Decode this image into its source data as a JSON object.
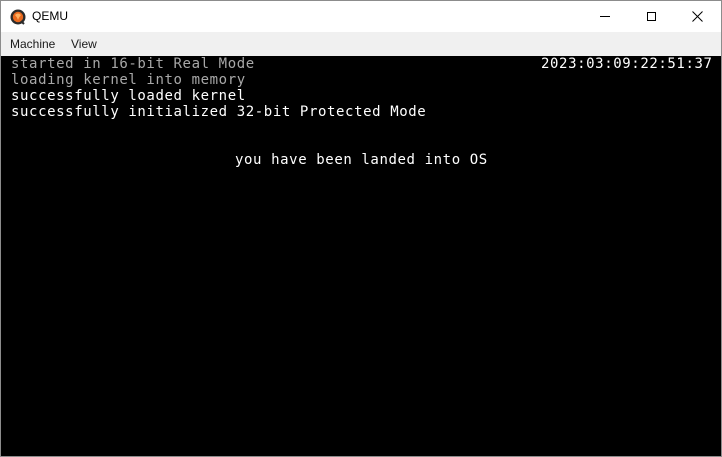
{
  "window": {
    "title": "QEMU",
    "icon": "qemu-logo-icon"
  },
  "controls": {
    "minimize_icon": "minimize-icon",
    "maximize_icon": "maximize-icon",
    "close_icon": "close-icon"
  },
  "menubar": {
    "items": [
      {
        "label": "Machine"
      },
      {
        "label": "View"
      }
    ]
  },
  "console": {
    "lines": [
      {
        "text": "started in 16-bit Real Mode",
        "color": "#a8a8a8"
      },
      {
        "text": "loading kernel into memory",
        "color": "#a8a8a8"
      },
      {
        "text": "successfully loaded kernel",
        "color": "#ffffff"
      },
      {
        "text": "successfully initialized 32-bit Protected Mode",
        "color": "#ffffff"
      }
    ],
    "clock": "2023:03:09:22:51:37",
    "message": "you have been landed into OS",
    "background": "#000000"
  }
}
